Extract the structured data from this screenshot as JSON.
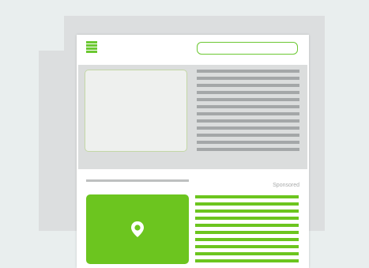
{
  "header": {
    "search_placeholder": ""
  },
  "ad": {
    "sponsored_label": "Sponsored"
  },
  "icons": {
    "menu": "hamburger-menu-icon",
    "pin": "location-pin-icon"
  },
  "colors": {
    "accent": "#6cc51f",
    "background": "#e9eeee",
    "text_line": "#a4a7a8"
  }
}
